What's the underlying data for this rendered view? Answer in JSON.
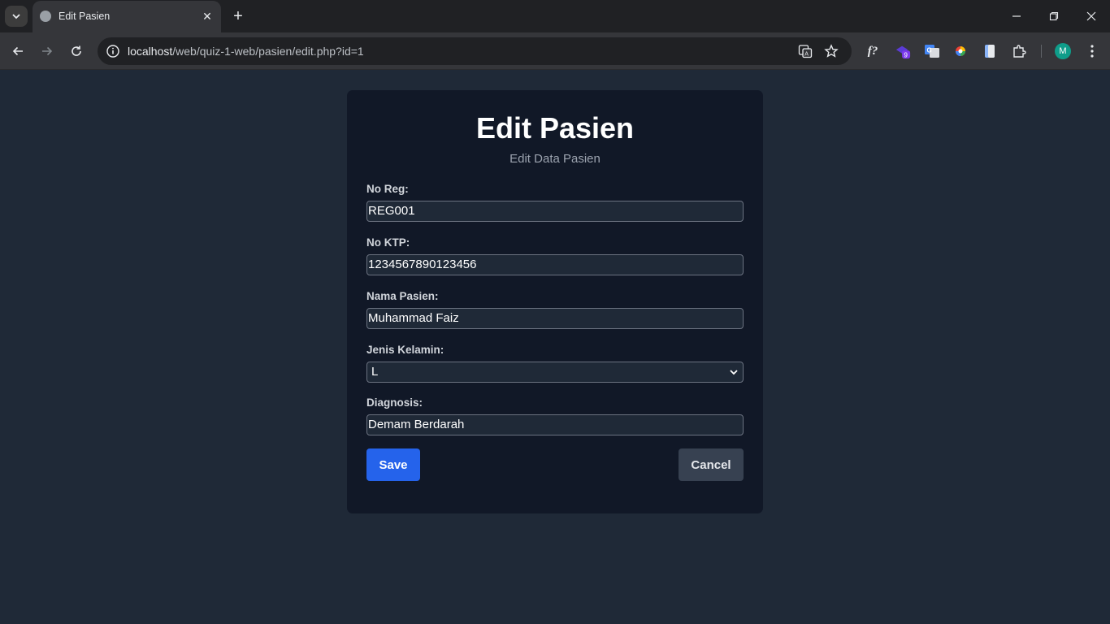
{
  "browser": {
    "tab_title": "Edit Pasien",
    "url_host": "localhost",
    "url_path": "/web/quiz-1-web/pasien/edit.php?id=1",
    "avatar_letter": "M",
    "extension_badge": "9"
  },
  "form": {
    "title": "Edit Pasien",
    "subtitle": "Edit Data Pasien",
    "fields": [
      {
        "label": "No Reg:",
        "value": "REG001"
      },
      {
        "label": "No KTP:",
        "value": "1234567890123456"
      },
      {
        "label": "Nama Pasien:",
        "value": "Muhammad Faiz"
      },
      {
        "label": "Jenis Kelamin:",
        "value": "L"
      },
      {
        "label": "Diagnosis:",
        "value": "Demam Berdarah"
      }
    ],
    "save_label": "Save",
    "cancel_label": "Cancel"
  },
  "colors": {
    "page_bg": "#1f2937",
    "card_bg": "#111827",
    "save_button": "#2563eb",
    "cancel_button": "#374151"
  }
}
